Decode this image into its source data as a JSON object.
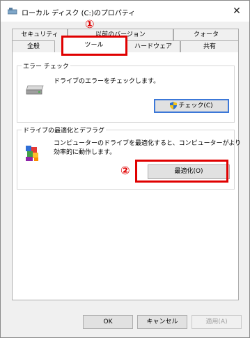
{
  "window": {
    "title": "ローカル ディスク (C:)のプロパティ",
    "close_glyph": "✕"
  },
  "tabs": {
    "row1": [
      "セキュリティ",
      "以前のバージョン",
      "クォータ"
    ],
    "row2": [
      "全般",
      "ツール",
      "ハードウェア",
      "共有"
    ],
    "active": "ツール"
  },
  "error_check": {
    "group_label": "エラー チェック",
    "description": "ドライブのエラーをチェックします。",
    "button_label": "チェック(C)",
    "icon": "drive-icon"
  },
  "optimize": {
    "group_label": "ドライブの最適化とデフラグ",
    "description_line1": "コンピューターのドライブを最適化すると、コンピューターがより",
    "description_line2": "効率的に動作します。",
    "button_label": "最適化(O)",
    "icon": "defrag-icon"
  },
  "footer": {
    "ok_label": "OK",
    "cancel_label": "キャンセル",
    "apply_label": "適用(A)"
  },
  "annotations": {
    "marker1": "①",
    "marker2": "②",
    "highlight_color": "#e00000"
  }
}
